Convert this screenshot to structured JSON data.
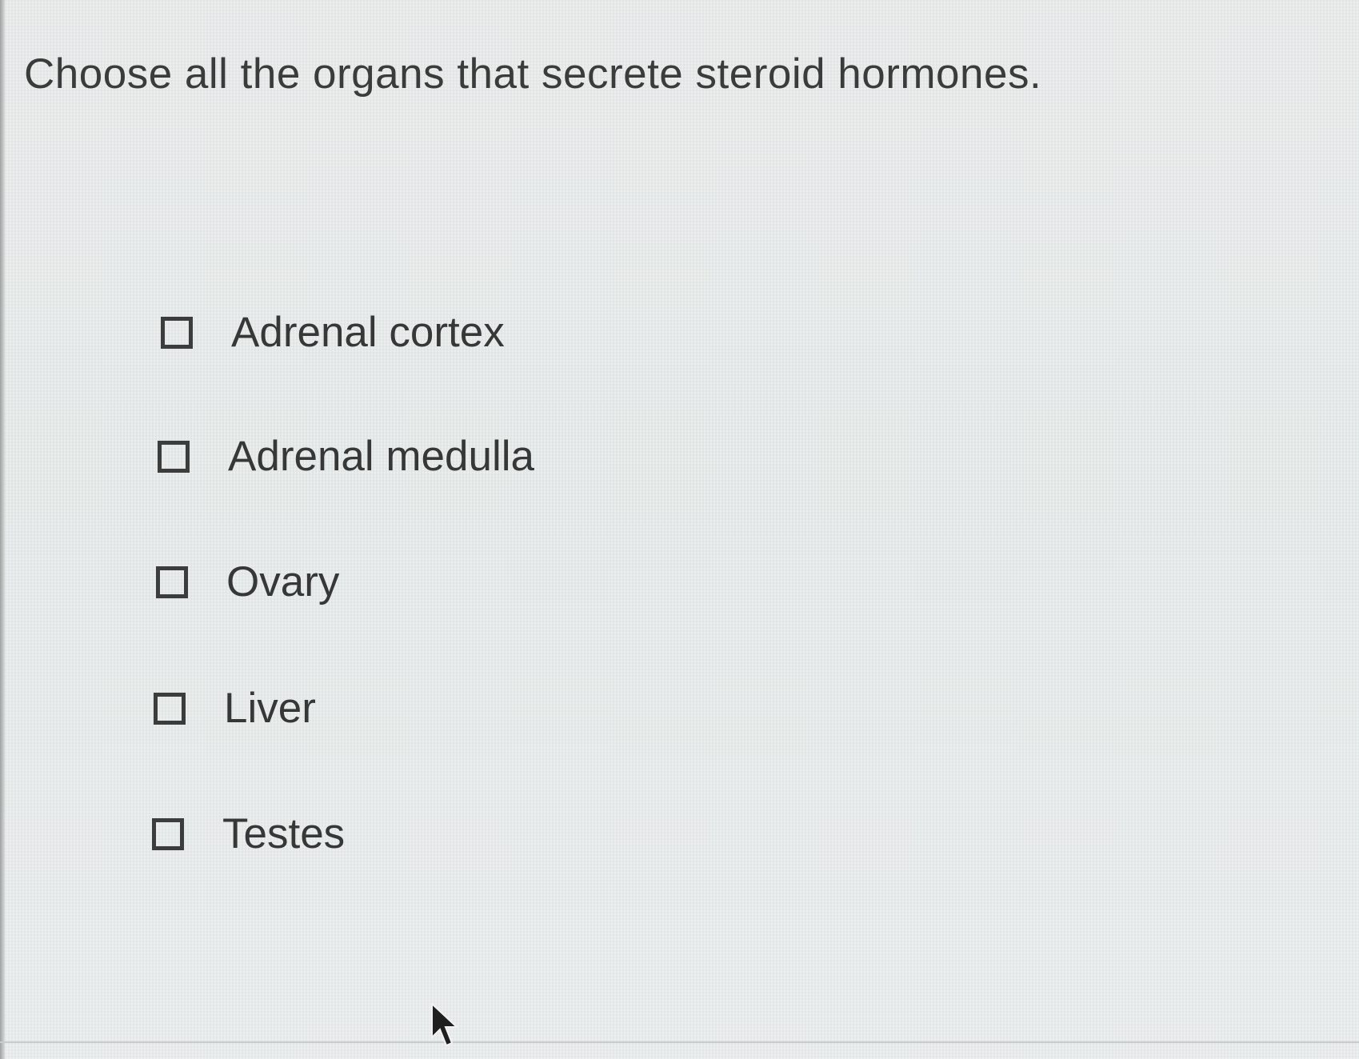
{
  "question": {
    "text": "Choose all the organs that secrete steroid hormones."
  },
  "options": [
    {
      "label": "Adrenal cortex",
      "checked": false
    },
    {
      "label": "Adrenal medulla",
      "checked": false
    },
    {
      "label": "Ovary",
      "checked": false
    },
    {
      "label": "Liver",
      "checked": false
    },
    {
      "label": "Testes",
      "checked": false
    }
  ],
  "icons": {
    "checkbox": "checkbox-icon",
    "pointer": "mouse-pointer-icon"
  },
  "colors": {
    "text": "#363737",
    "background": "#e4e7e6"
  }
}
